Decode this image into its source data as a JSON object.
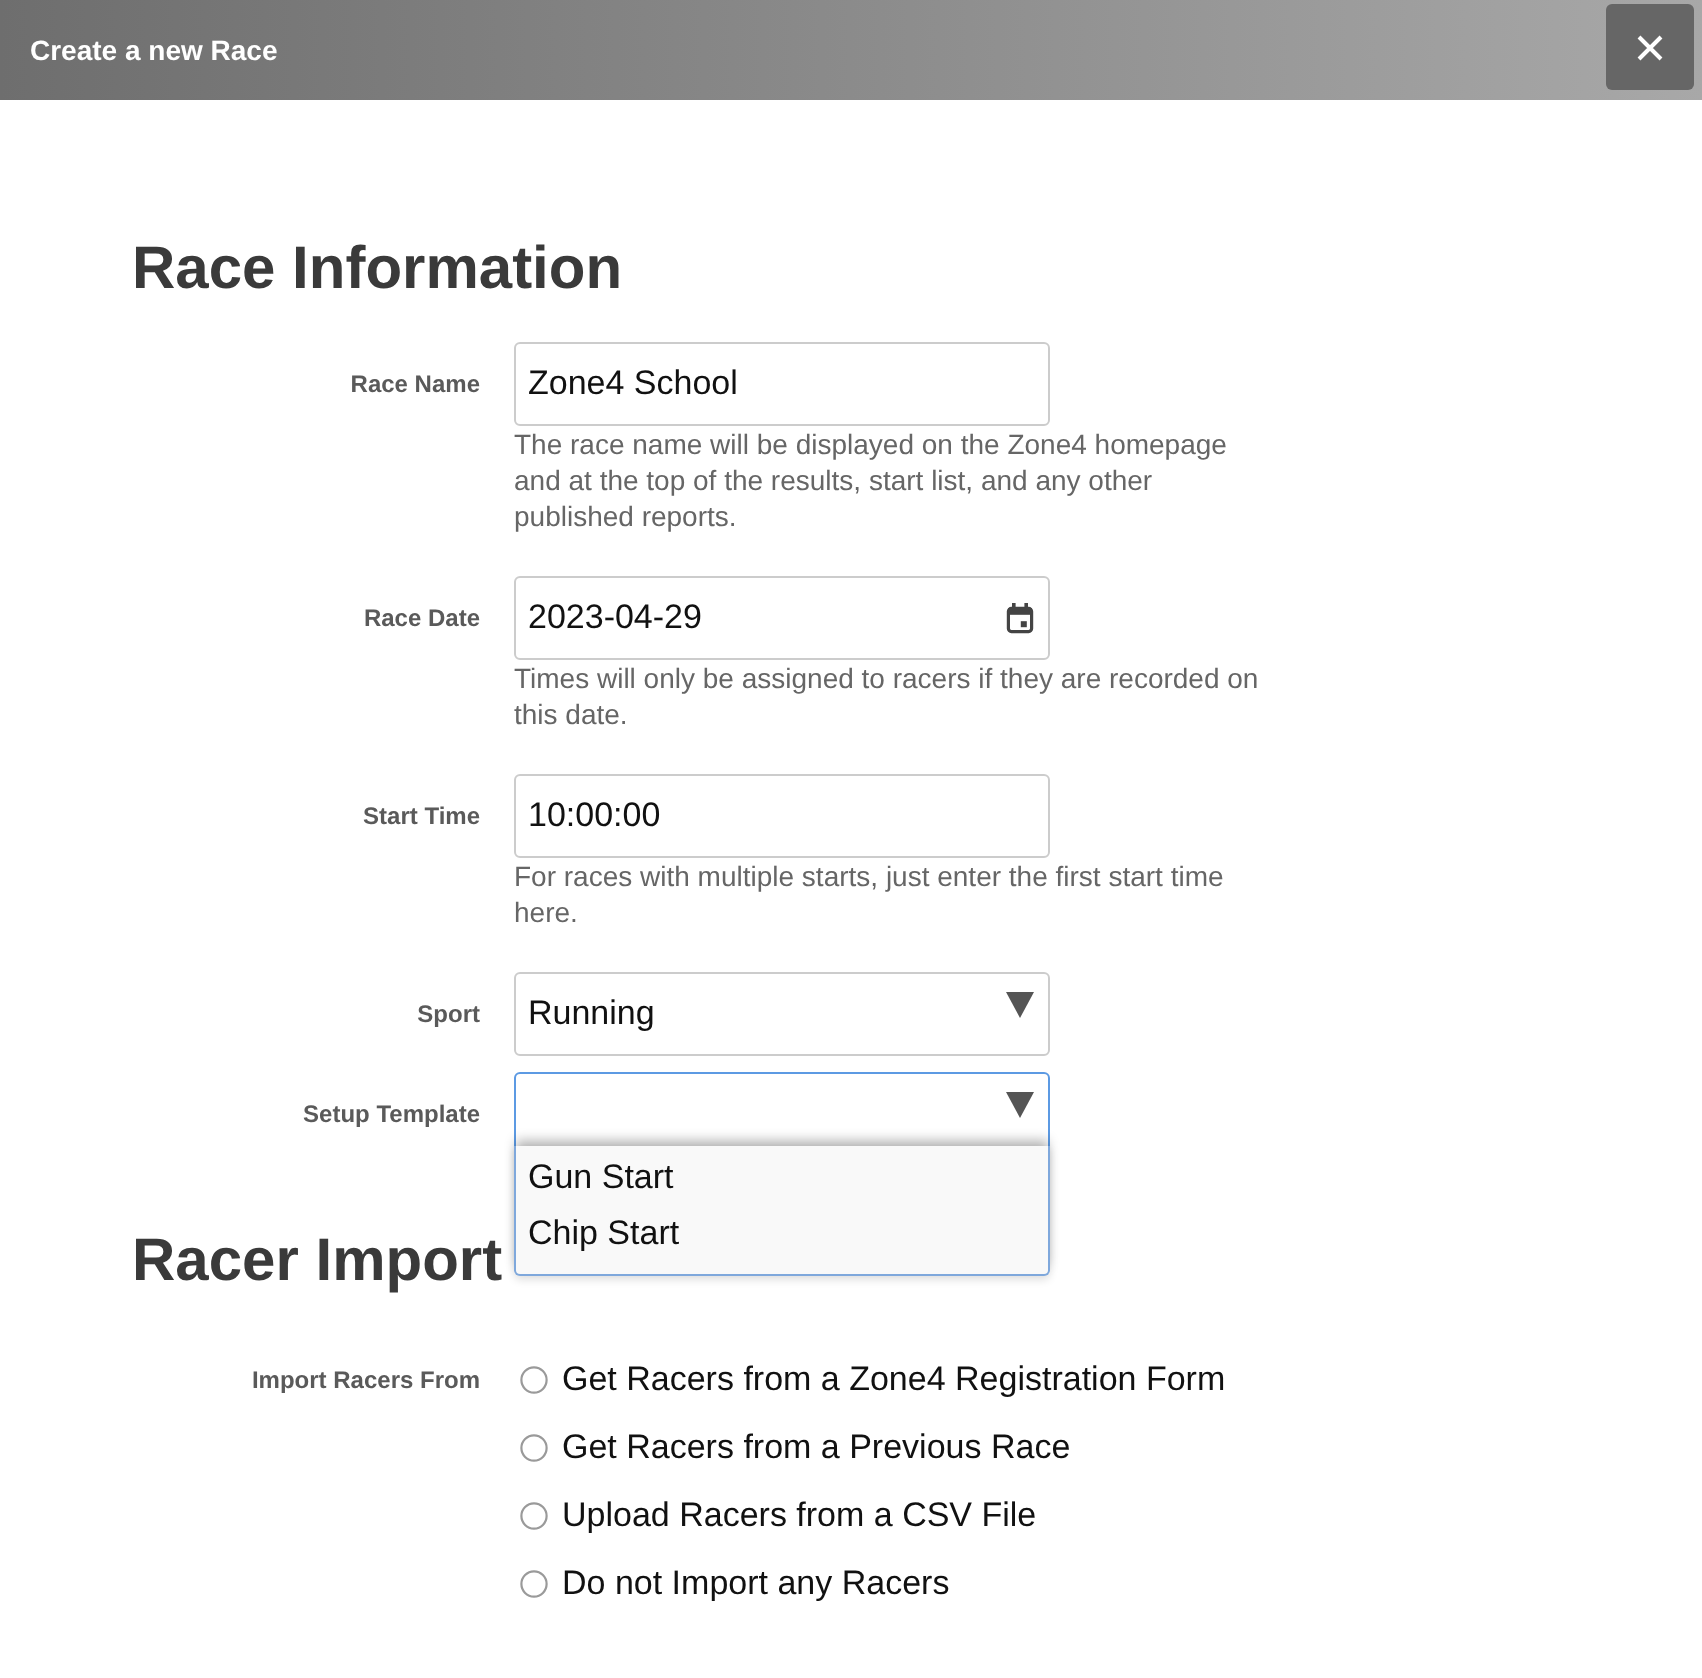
{
  "dialog": {
    "title": "Create a new Race"
  },
  "sections": [
    {
      "heading": "Race Information",
      "fields": [
        {
          "kind": "text",
          "label": "Race Name",
          "value": "Zone4 School",
          "help": "The race name will be displayed on the Zone4 homepage and at the top of the results, start list, and any other published reports."
        },
        {
          "kind": "date",
          "label": "Race Date",
          "value": "2023-04-29",
          "help": "Times will only be assigned to racers if they are recorded on this date."
        },
        {
          "kind": "text",
          "label": "Start Time",
          "value": "10:00:00",
          "help": "For races with multiple starts, just enter the first start time here."
        },
        {
          "kind": "select",
          "label": "Sport",
          "value": "Running",
          "expanded": false
        },
        {
          "kind": "select",
          "label": "Setup Template",
          "expanded": true,
          "options": [
            {
              "label": "Gun Start",
              "selected": false
            },
            {
              "label": "Chip Start",
              "selected": false
            }
          ]
        }
      ]
    },
    {
      "heading": "Racer Import",
      "fields": [
        {
          "kind": "radio_group",
          "label": "Import Racers From",
          "options": [
            {
              "label": "Get Racers from a Zone4 Registration Form",
              "selected": false
            },
            {
              "label": "Get Racers from a Previous Race",
              "selected": false
            },
            {
              "label": "Upload Racers from a CSV File",
              "selected": false
            },
            {
              "label": "Do not Import any Racers",
              "selected": false
            }
          ]
        }
      ]
    }
  ]
}
